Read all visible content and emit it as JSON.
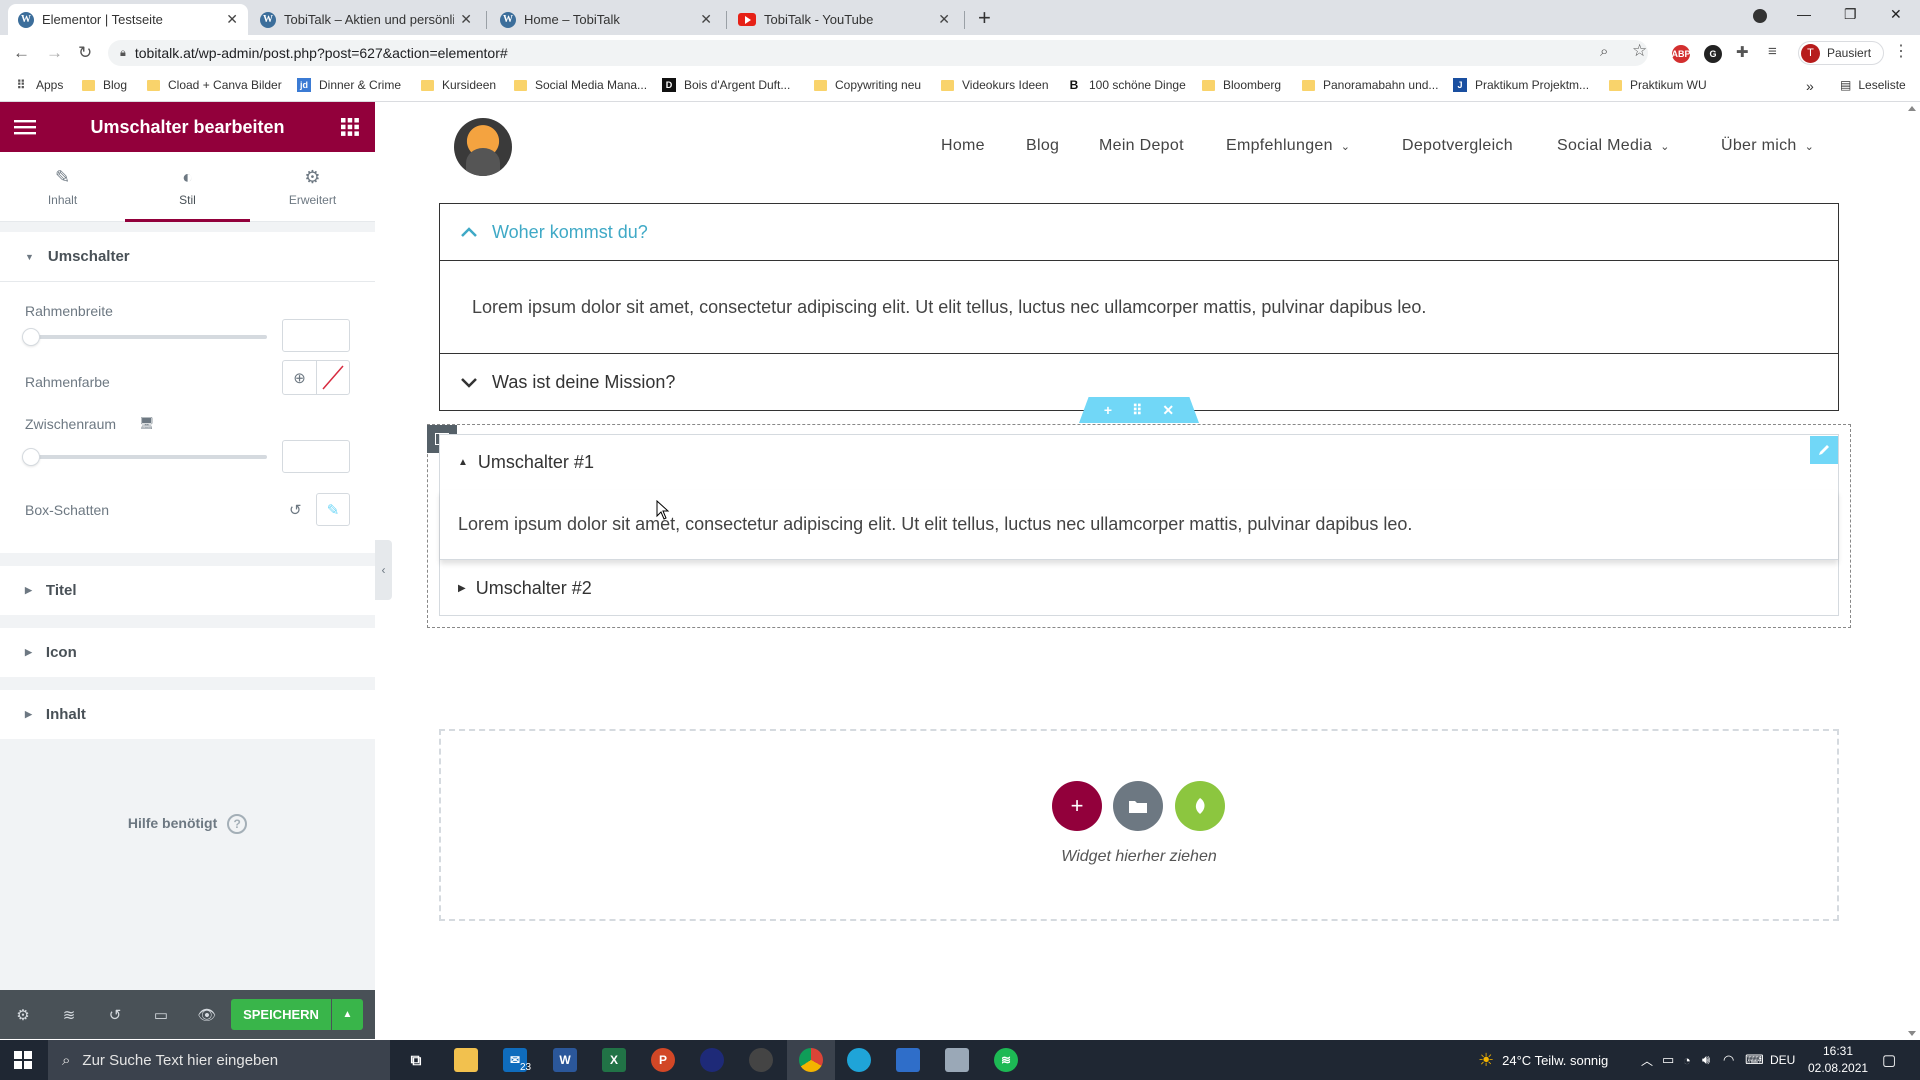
{
  "browser": {
    "tabs": [
      {
        "title": "Elementor | Testseite",
        "icon": "wordpress-icon",
        "active": true
      },
      {
        "title": "TobiTalk – Aktien und persönlich…",
        "icon": "wordpress-icon",
        "active": false
      },
      {
        "title": "Home – TobiTalk",
        "icon": "wordpress-icon",
        "active": false
      },
      {
        "title": "TobiTalk - YouTube",
        "icon": "youtube-icon",
        "active": false
      }
    ],
    "url": "tobitalk.at/wp-admin/post.php?post=627&action=elementor#",
    "profile_initial": "T",
    "profile_label": "Pausiert",
    "bookmarks": [
      "Apps",
      "Blog",
      "Cload + Canva Bilder",
      "Dinner & Crime",
      "Kursideen",
      "Social Media Mana...",
      "Bois d'Argent Duft...",
      "Copywriting neu",
      "Videokurs Ideen",
      "100 schöne Dinge",
      "Bloomberg",
      "Panoramabahn und...",
      "Praktikum Projektm...",
      "Praktikum WU"
    ],
    "reading_list": "Leseliste"
  },
  "panel": {
    "title": "Umschalter bearbeiten",
    "tabs": [
      "Inhalt",
      "Stil",
      "Erweitert"
    ],
    "active_tab": "Stil",
    "section_title": "Umschalter",
    "controls": {
      "border_width": "Rahmenbreite",
      "border_color": "Rahmenfarbe",
      "spacing": "Zwischenraum",
      "box_shadow": "Box-Schatten"
    },
    "collapsed_sections": [
      "Titel",
      "Icon",
      "Inhalt"
    ],
    "help": "Hilfe benötigt",
    "save_label": "SPEICHERN",
    "accent_color": "#92003b",
    "save_color": "#39b54a"
  },
  "site": {
    "nav": [
      "Home",
      "Blog",
      "Mein Depot",
      "Empfehlungen",
      "Depotvergleich",
      "Social Media",
      "Über mich"
    ],
    "accordion": {
      "item1_title": "Woher kommst du?",
      "item1_content": "Lorem ipsum dolor sit amet, consectetur adipiscing elit. Ut elit tellus, luctus nec ullamcorper mattis, pulvinar dapibus leo.",
      "item2_title": "Was ist deine Mission?"
    },
    "toggle": {
      "item1_title": "Umschalter #1",
      "item1_content": "Lorem ipsum dolor sit amet, consectetur adipiscing elit. Ut elit tellus, luctus nec ullamcorper mattis, pulvinar dapibus leo.",
      "item2_title": "Umschalter #2"
    },
    "dropzone_text": "Widget hierher ziehen",
    "link_color": "#3fa9c6"
  },
  "taskbar": {
    "search_placeholder": "Zur Suche Text hier eingeben",
    "mail_badge": "23",
    "weather": "24°C  Teilw. sonnig",
    "language": "DEU",
    "time": "16:31",
    "date": "02.08.2021"
  }
}
